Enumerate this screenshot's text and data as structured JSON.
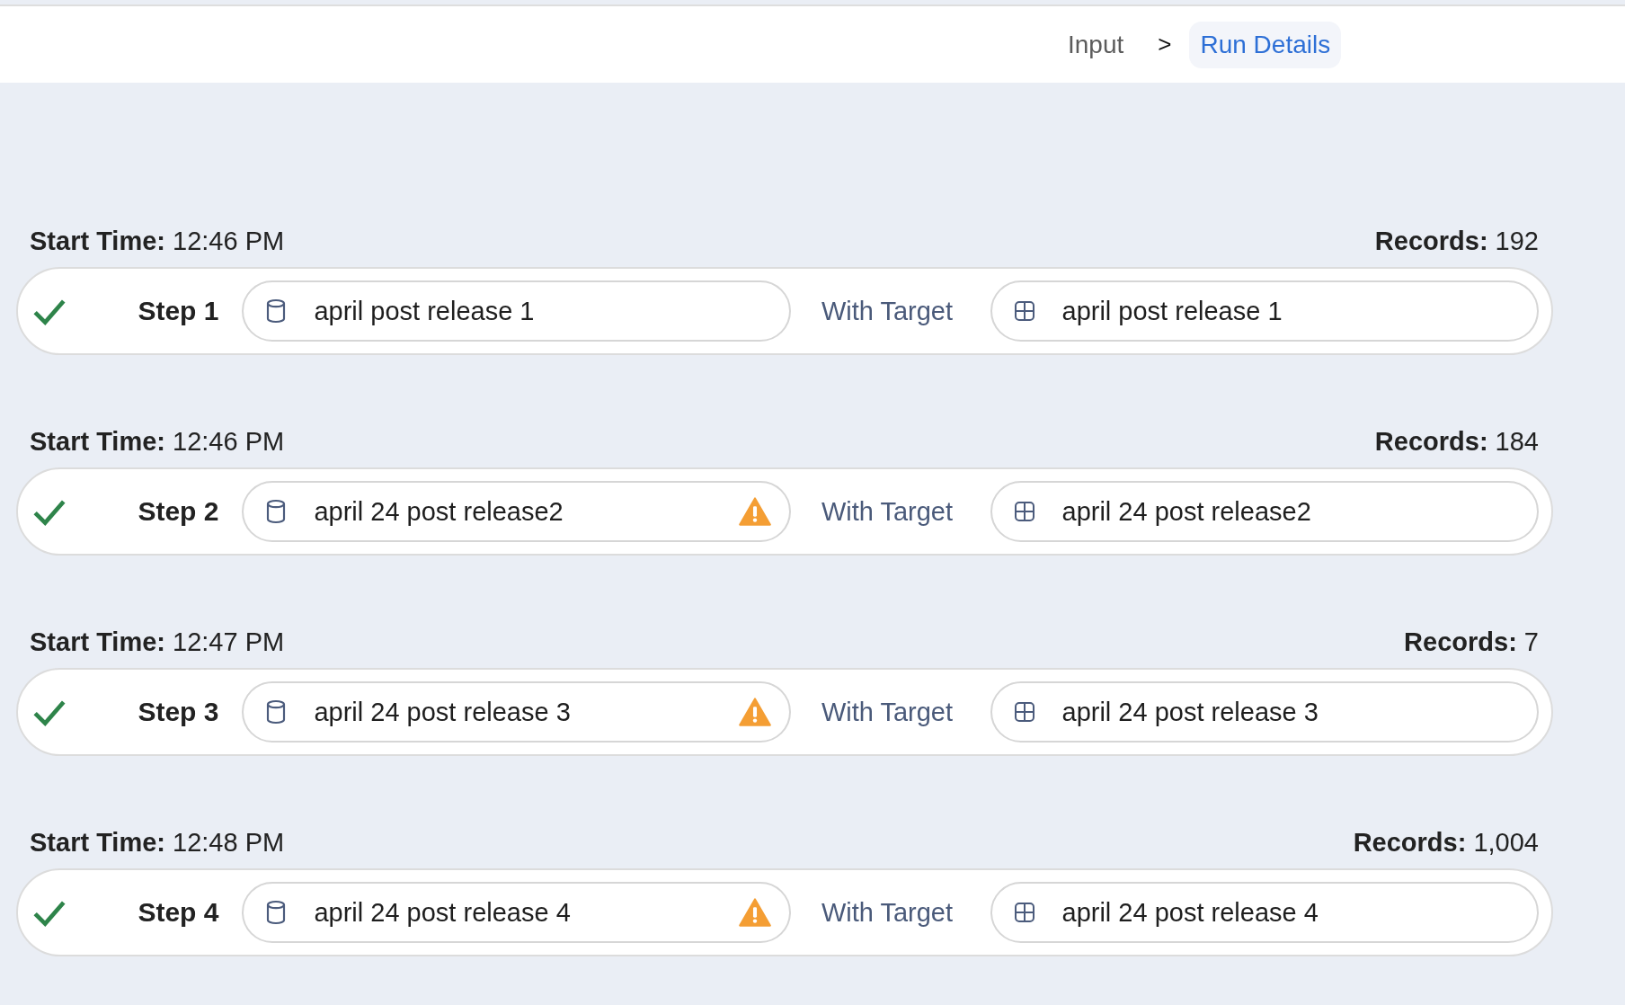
{
  "breadcrumb": [
    {
      "label": "Input",
      "selected": false
    },
    {
      "label": "Run Details",
      "selected": true
    }
  ],
  "breadcrumb_separator": ">",
  "steps": [
    {
      "start_time_label": "Start Time:",
      "start_time": "12:46 PM",
      "records_label": "Records:",
      "records": "192",
      "completed": true,
      "step": "Step 1",
      "source": "april post release 1",
      "warning": false,
      "connector": "With Target",
      "target": "april post release 1"
    },
    {
      "start_time_label": "Start Time:",
      "start_time": "12:46 PM",
      "records_label": "Records:",
      "records": "184",
      "completed": true,
      "step": "Step 2",
      "source": "april 24 post release2",
      "warning": true,
      "connector": "With Target",
      "target": "april 24 post release2"
    },
    {
      "start_time_label": "Start Time:",
      "start_time": "12:47 PM",
      "records_label": "Records:",
      "records": "7",
      "completed": true,
      "step": "Step 3",
      "source": "april 24 post release 3",
      "warning": true,
      "connector": "With Target",
      "target": "april 24 post release 3"
    },
    {
      "start_time_label": "Start Time:",
      "start_time": "12:48 PM",
      "records_label": "Records:",
      "records": "1,004",
      "completed": true,
      "step": "Step 4",
      "source": "april 24 post release 4",
      "warning": true,
      "connector": "With Target",
      "target": "april 24 post release 4"
    }
  ]
}
